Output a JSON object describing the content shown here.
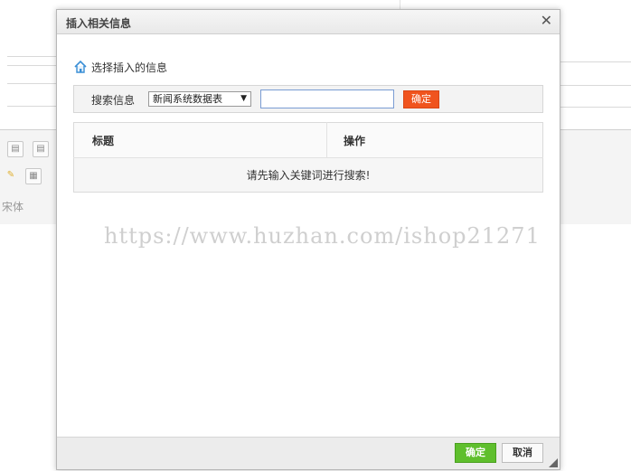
{
  "dialog": {
    "title": "插入相关信息",
    "close_icon": "close-icon",
    "section_title": "选择插入的信息",
    "search": {
      "label": "搜索信息",
      "select_value": "新闻系统数据表",
      "input_value": "",
      "button_label": "确定"
    },
    "table": {
      "headers": [
        "标题",
        "操作"
      ],
      "empty_message": "请先输入关键词进行搜索!"
    },
    "footer": {
      "ok_label": "确定",
      "cancel_label": "取消"
    },
    "colors": {
      "search_button": "#f0541e",
      "ok_button": "#5fbf2d"
    }
  },
  "watermark": "https://www.huzhan.com/ishop21271",
  "background": {
    "font_label": "宋体"
  }
}
